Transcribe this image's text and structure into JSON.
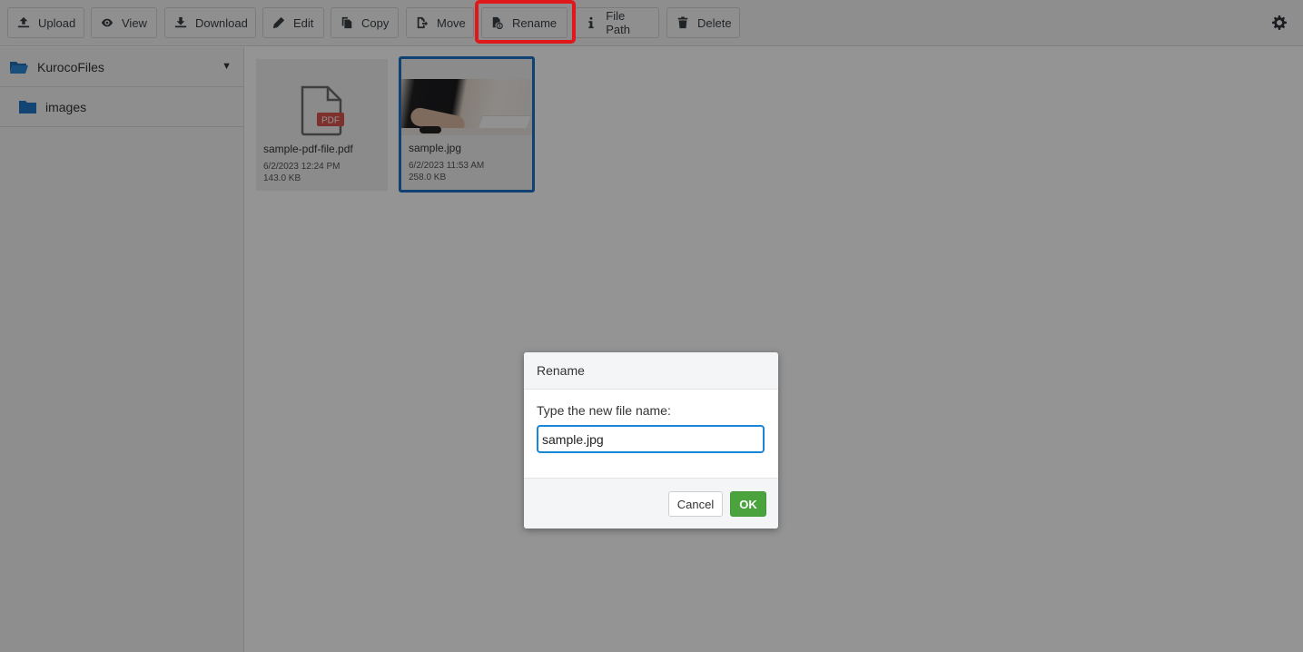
{
  "toolbar": {
    "buttons": [
      {
        "label": "Upload",
        "icon": "upload-icon"
      },
      {
        "label": "View",
        "icon": "eye-icon"
      },
      {
        "label": "Download",
        "icon": "download-icon"
      },
      {
        "label": "Edit",
        "icon": "pencil-icon"
      },
      {
        "label": "Copy",
        "icon": "copy-icon"
      },
      {
        "label": "Move",
        "icon": "move-icon"
      },
      {
        "label": "Rename",
        "icon": "rename-icon"
      },
      {
        "label": "File Path",
        "icon": "info-icon"
      },
      {
        "label": "Delete",
        "icon": "trash-icon"
      }
    ],
    "settings_icon": "gear-icon",
    "highlighted_button": "Rename"
  },
  "sidebar": {
    "root": {
      "label": "KurocoFiles",
      "icon": "folder-open-icon"
    },
    "children": [
      {
        "label": "images",
        "icon": "folder-icon"
      }
    ]
  },
  "files": [
    {
      "name": "sample-pdf-file.pdf",
      "date": "6/2/2023 12:24 PM",
      "size": "143.0 KB",
      "type_badge": "PDF",
      "selected": false
    },
    {
      "name": "sample.jpg",
      "date": "6/2/2023 11:53 AM",
      "size": "258.0 KB",
      "selected": true
    }
  ],
  "modal": {
    "title": "Rename",
    "prompt": "Type the new file name:",
    "input_value": "sample.jpg",
    "cancel_label": "Cancel",
    "ok_label": "OK"
  },
  "colors": {
    "accent": "#1a73c4",
    "ok_button": "#4aa33c",
    "highlight": "#e0181b",
    "pdf_badge": "#d9534f"
  }
}
